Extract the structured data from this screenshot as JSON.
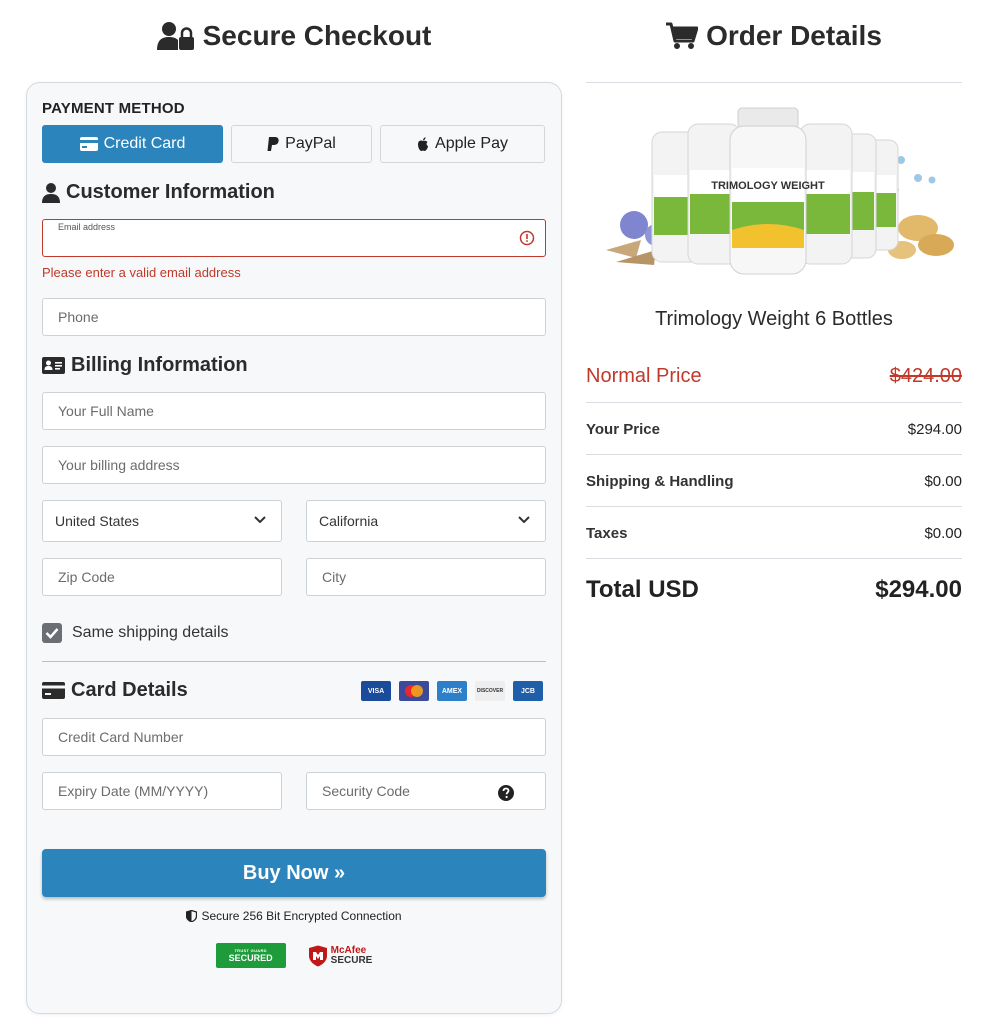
{
  "checkout": {
    "title": "Secure Checkout",
    "payment_method_label": "PAYMENT METHOD",
    "payment_methods": [
      "Credit Card",
      "PayPal",
      "Apple Pay"
    ],
    "active_payment_method": "Credit Card",
    "customer_heading": "Customer Information",
    "email_label": "Email address",
    "email_value": "",
    "email_error": "Please enter a valid email address",
    "phone_placeholder": "Phone",
    "billing_heading": "Billing Information",
    "full_name_placeholder": "Your Full Name",
    "address_placeholder": "Your billing address",
    "country_value": "United States",
    "state_value": "California",
    "zip_placeholder": "Zip Code",
    "city_placeholder": "City",
    "same_shipping_label": "Same shipping details",
    "same_shipping_checked": true,
    "card_heading": "Card Details",
    "card_brands": [
      "VISA",
      "Mastercard",
      "AMEX",
      "DISCOVER",
      "JCB"
    ],
    "card_number_placeholder": "Credit Card Number",
    "expiry_placeholder": "Expiry Date (MM/YYYY)",
    "security_code_placeholder": "Security Code",
    "buy_label": "Buy Now »",
    "secure_text": "Secure 256 Bit Encrypted Connection",
    "badges": {
      "trusted_small": "TRUST GUARD",
      "trusted_main": "SECURED",
      "mcafee_top": "McAfee",
      "mcafee_bottom": "SECURE"
    }
  },
  "order": {
    "title": "Order Details",
    "product_label": "TRIMOLOGY WEIGHT",
    "product_name": "Trimology Weight 6 Bottles",
    "normal_price_label": "Normal Price",
    "normal_price": "$424.00",
    "your_price_label": "Your Price",
    "your_price": "$294.00",
    "shipping_label": "Shipping & Handling",
    "shipping": "$0.00",
    "taxes_label": "Taxes",
    "taxes": "$0.00",
    "total_label": "Total USD",
    "total": "$294.00"
  },
  "colors": {
    "accent": "#2c84bd",
    "error": "#c0392b",
    "bottle_green": "#7ab83c"
  }
}
